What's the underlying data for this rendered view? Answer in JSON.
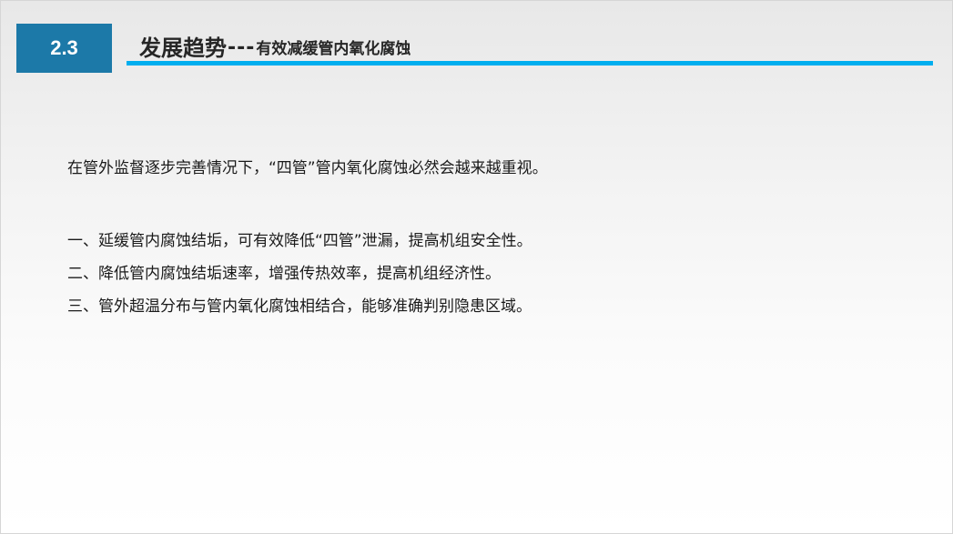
{
  "slide": {
    "section_number": "2.3",
    "title_main": "发展趋势",
    "title_separator": "---",
    "title_sub": "有效减缓管内氧化腐蚀",
    "colors": {
      "badge": "#1c79a8",
      "rule": "#00aeef",
      "text": "#1a1a1a"
    }
  },
  "body": {
    "intro": "在管外监督逐步完善情况下，“四管”管内氧化腐蚀必然会越来越重视。",
    "points": [
      "一、延缓管内腐蚀结垢，可有效降低“四管”泄漏，提高机组安全性。",
      "二、降低管内腐蚀结垢速率，增强传热效率，提高机组经济性。",
      "三、管外超温分布与管内氧化腐蚀相结合，能够准确判别隐患区域。"
    ]
  }
}
